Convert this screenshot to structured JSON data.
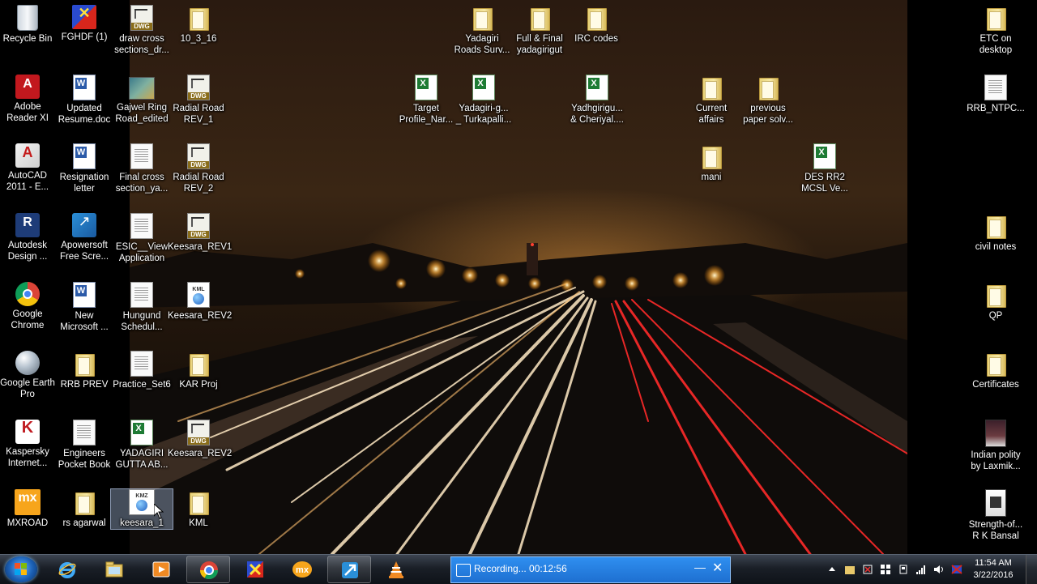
{
  "desktop_icons": {
    "recycle_bin": "Recycle Bin",
    "adobe_reader": "Adobe\nReader XI",
    "autocad": "AutoCAD\n2011 - E...",
    "autodesk_design": "Autodesk\nDesign ...",
    "google_chrome": "Google\nChrome",
    "google_earth": "Google Earth\nPro",
    "kaspersky": "Kaspersky\nInternet...",
    "mxroad": "MXROAD",
    "fghdf": "FGHDF (1)",
    "updated_resume": "Updated\nResume.doc",
    "resignation_letter": "Resignation\nletter",
    "apowersoft": "Apowersoft\nFree Scre...",
    "new_microsoft": "New\nMicrosoft ...",
    "rrb_prev": "RRB PREV",
    "engineers_pocket_book": "Engineers\nPocket Book",
    "rs_agarwal": "rs agarwal",
    "draw_cross_sections": "draw cross\nsections_dr...",
    "gajwel_ring_road": "Gajwel Ring\nRoad_edited",
    "final_cross_section": "Final cross\nsection_ya...",
    "esic_view_application": "ESIC__View\nApplication",
    "hungund_schedule": "Hungund\nSchedul...",
    "practice_set6": "Practice_Set6",
    "yadagiri_gutta": "YADAGIRI\nGUTTA AB...",
    "keesara_1": "keesara_1",
    "folder_10_3_16": "10_3_16",
    "radial_road_rev1": "Radial Road\nREV_1",
    "radial_road_rev2": "Radial Road\nREV_2",
    "keesara_rev1": "Keesara_REV1",
    "keesara_rev2_kml": "Keesara_REV2",
    "kar_proj": "KAR Proj",
    "keesara_rev2_dwg": "Keesara_REV2",
    "kml_folder": "KML",
    "yadagiri_roads_survey": "Yadagiri\nRoads Surv...",
    "full_final_yadagirigut": "Full & Final\nyadagirigut",
    "irc_codes": "IRC codes",
    "target_profile": "Target\nProfile_Nar...",
    "yadagiri_turkapalli": "Yadagiri-g...\n_ Turkapalli...",
    "yadhgirigu_cheriyal": "Yadhgirigu...\n& Cheriyal....",
    "current_affairs": "Current\naffairs",
    "previous_paper": "previous\npaper solv...",
    "mani": "mani",
    "des_rr2": "DES RR2\nMCSL Ve...",
    "etc_on_desktop": "ETC on\ndesktop",
    "rrb_ntpc": "RRB_NTPC...",
    "civil_notes": "civil notes",
    "qp": "QP",
    "certificates": "Certificates",
    "indian_polity": "Indian polity\nby  Laxmik...",
    "strength_of": "Strength-of...\nR K Bansal"
  },
  "icon_badges": {
    "dwg": "DWG",
    "kml": "KML",
    "kmz": "KMZ"
  },
  "taskbar": {
    "pinned": [
      "start-orb",
      "internet-explorer-icon",
      "file-explorer-icon",
      "media-player-icon",
      "google-chrome-icon",
      "fghdf-app-icon",
      "mxroad-icon",
      "apowersoft-icon",
      "vlc-icon"
    ],
    "recording_text": "Recording... 00:12:56",
    "minimize_glyph": "—",
    "close_glyph": "✕"
  },
  "tray": {
    "time": "11:54 AM",
    "date": "3/22/2016"
  },
  "colors": {
    "taskbar": "#1a1f27",
    "recording_bar": "#1e6fd0",
    "folder": "#e9d37a"
  }
}
